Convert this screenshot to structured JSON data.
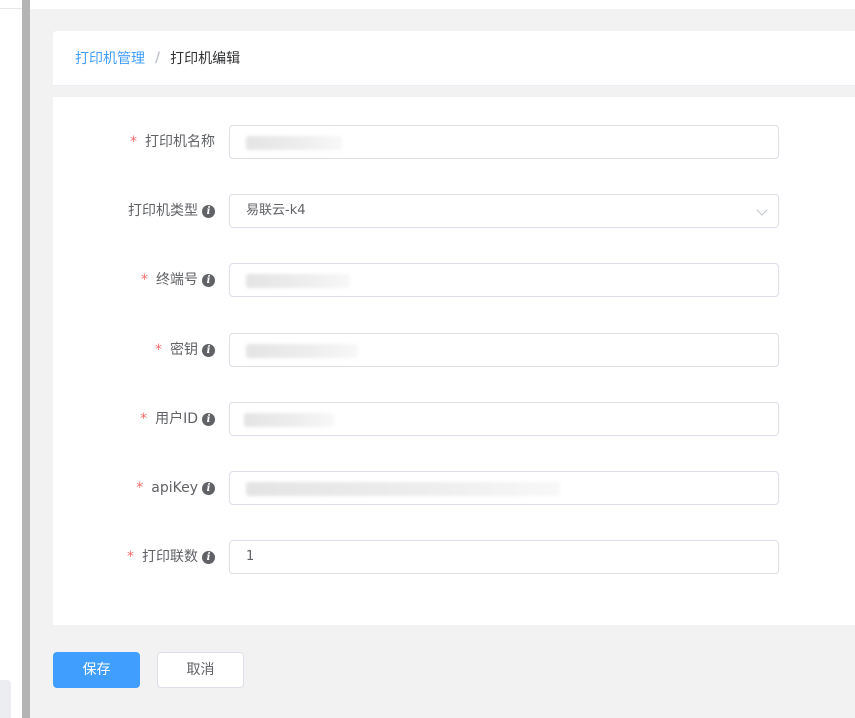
{
  "breadcrumb": {
    "parent": "打印机管理",
    "separator": "/",
    "current": "打印机编辑"
  },
  "form": {
    "fields": [
      {
        "label": "打印机名称",
        "required": true,
        "info": false,
        "value": ""
      },
      {
        "label": "打印机类型",
        "required": false,
        "info": true,
        "value": "易联云-k4"
      },
      {
        "label": "终端号",
        "required": true,
        "info": true,
        "value": ""
      },
      {
        "label": "密钥",
        "required": true,
        "info": true,
        "value": ""
      },
      {
        "label": "用户ID",
        "required": true,
        "info": true,
        "value": ""
      },
      {
        "label": "apiKey",
        "required": true,
        "info": true,
        "value": ""
      },
      {
        "label": "打印联数",
        "required": true,
        "info": true,
        "value": "1"
      }
    ],
    "required_mark": "*",
    "info_glyph": "i"
  },
  "actions": {
    "save": "保存",
    "cancel": "取消"
  },
  "colors": {
    "primary": "#409eff",
    "required": "#f56c6c"
  }
}
